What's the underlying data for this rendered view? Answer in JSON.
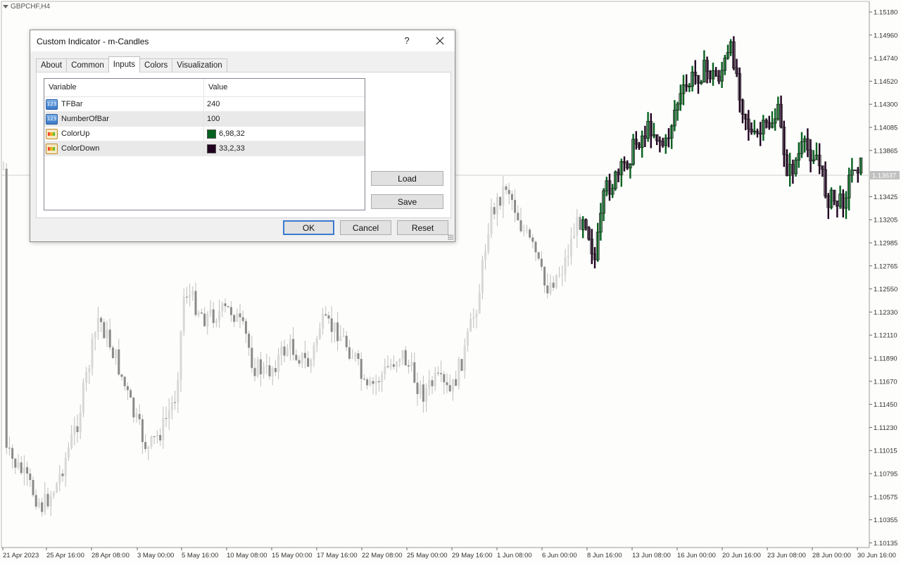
{
  "chart": {
    "symbol": "GBPCHF,H4",
    "current_price": "1.13637",
    "price_labels": [
      "1.15180",
      "1.14960",
      "1.14740",
      "1.14520",
      "1.14300",
      "1.14085",
      "1.13865",
      "1.13425",
      "1.13205",
      "1.12985",
      "1.12765",
      "1.12550",
      "1.12330",
      "1.12110",
      "1.11890",
      "1.11670",
      "1.11450",
      "1.11230",
      "1.11015",
      "1.10795",
      "1.10575",
      "1.10355",
      "1.10135"
    ],
    "date_labels": [
      "21 Apr 2023",
      "25 Apr 16:00",
      "28 Apr 08:00",
      "3 May 00:00",
      "5 May 16:00",
      "10 May 08:00",
      "15 May 00:00",
      "17 May 16:00",
      "22 May 08:00",
      "25 May 00:00",
      "29 May 16:00",
      "1 Jun 08:00",
      "6 Jun 00:00",
      "8 Jun 16:00",
      "13 Jun 08:00",
      "16 Jun 00:00",
      "20 Jun 16:00",
      "23 Jun 08:00",
      "28 Jun 00:00",
      "30 Jun 16:00"
    ],
    "colors": {
      "up": "#066220",
      "down": "#210221",
      "history": "#9a9a9a",
      "grid": "#cfcfcf"
    }
  },
  "dialog": {
    "title": "Custom Indicator - m-Candles",
    "help_label": "?",
    "tabs": [
      {
        "label": "About",
        "active": false
      },
      {
        "label": "Common",
        "active": false
      },
      {
        "label": "Inputs",
        "active": true
      },
      {
        "label": "Colors",
        "active": false
      },
      {
        "label": "Visualization",
        "active": false
      }
    ],
    "table": {
      "col_variable": "Variable",
      "col_value": "Value",
      "rows": [
        {
          "name": "TFBar",
          "value": "240",
          "icon": "number-icon"
        },
        {
          "name": "NumberOfBar",
          "value": "100",
          "icon": "number-icon"
        },
        {
          "name": "ColorUp",
          "value": "6,98,32",
          "icon": "color-icon",
          "swatch": "#066220"
        },
        {
          "name": "ColorDown",
          "value": "33,2,33",
          "icon": "color-icon",
          "swatch": "#210221"
        }
      ]
    },
    "number_icon_text": "123",
    "buttons": {
      "load": "Load",
      "save": "Save",
      "ok": "OK",
      "cancel": "Cancel",
      "reset": "Reset"
    }
  }
}
